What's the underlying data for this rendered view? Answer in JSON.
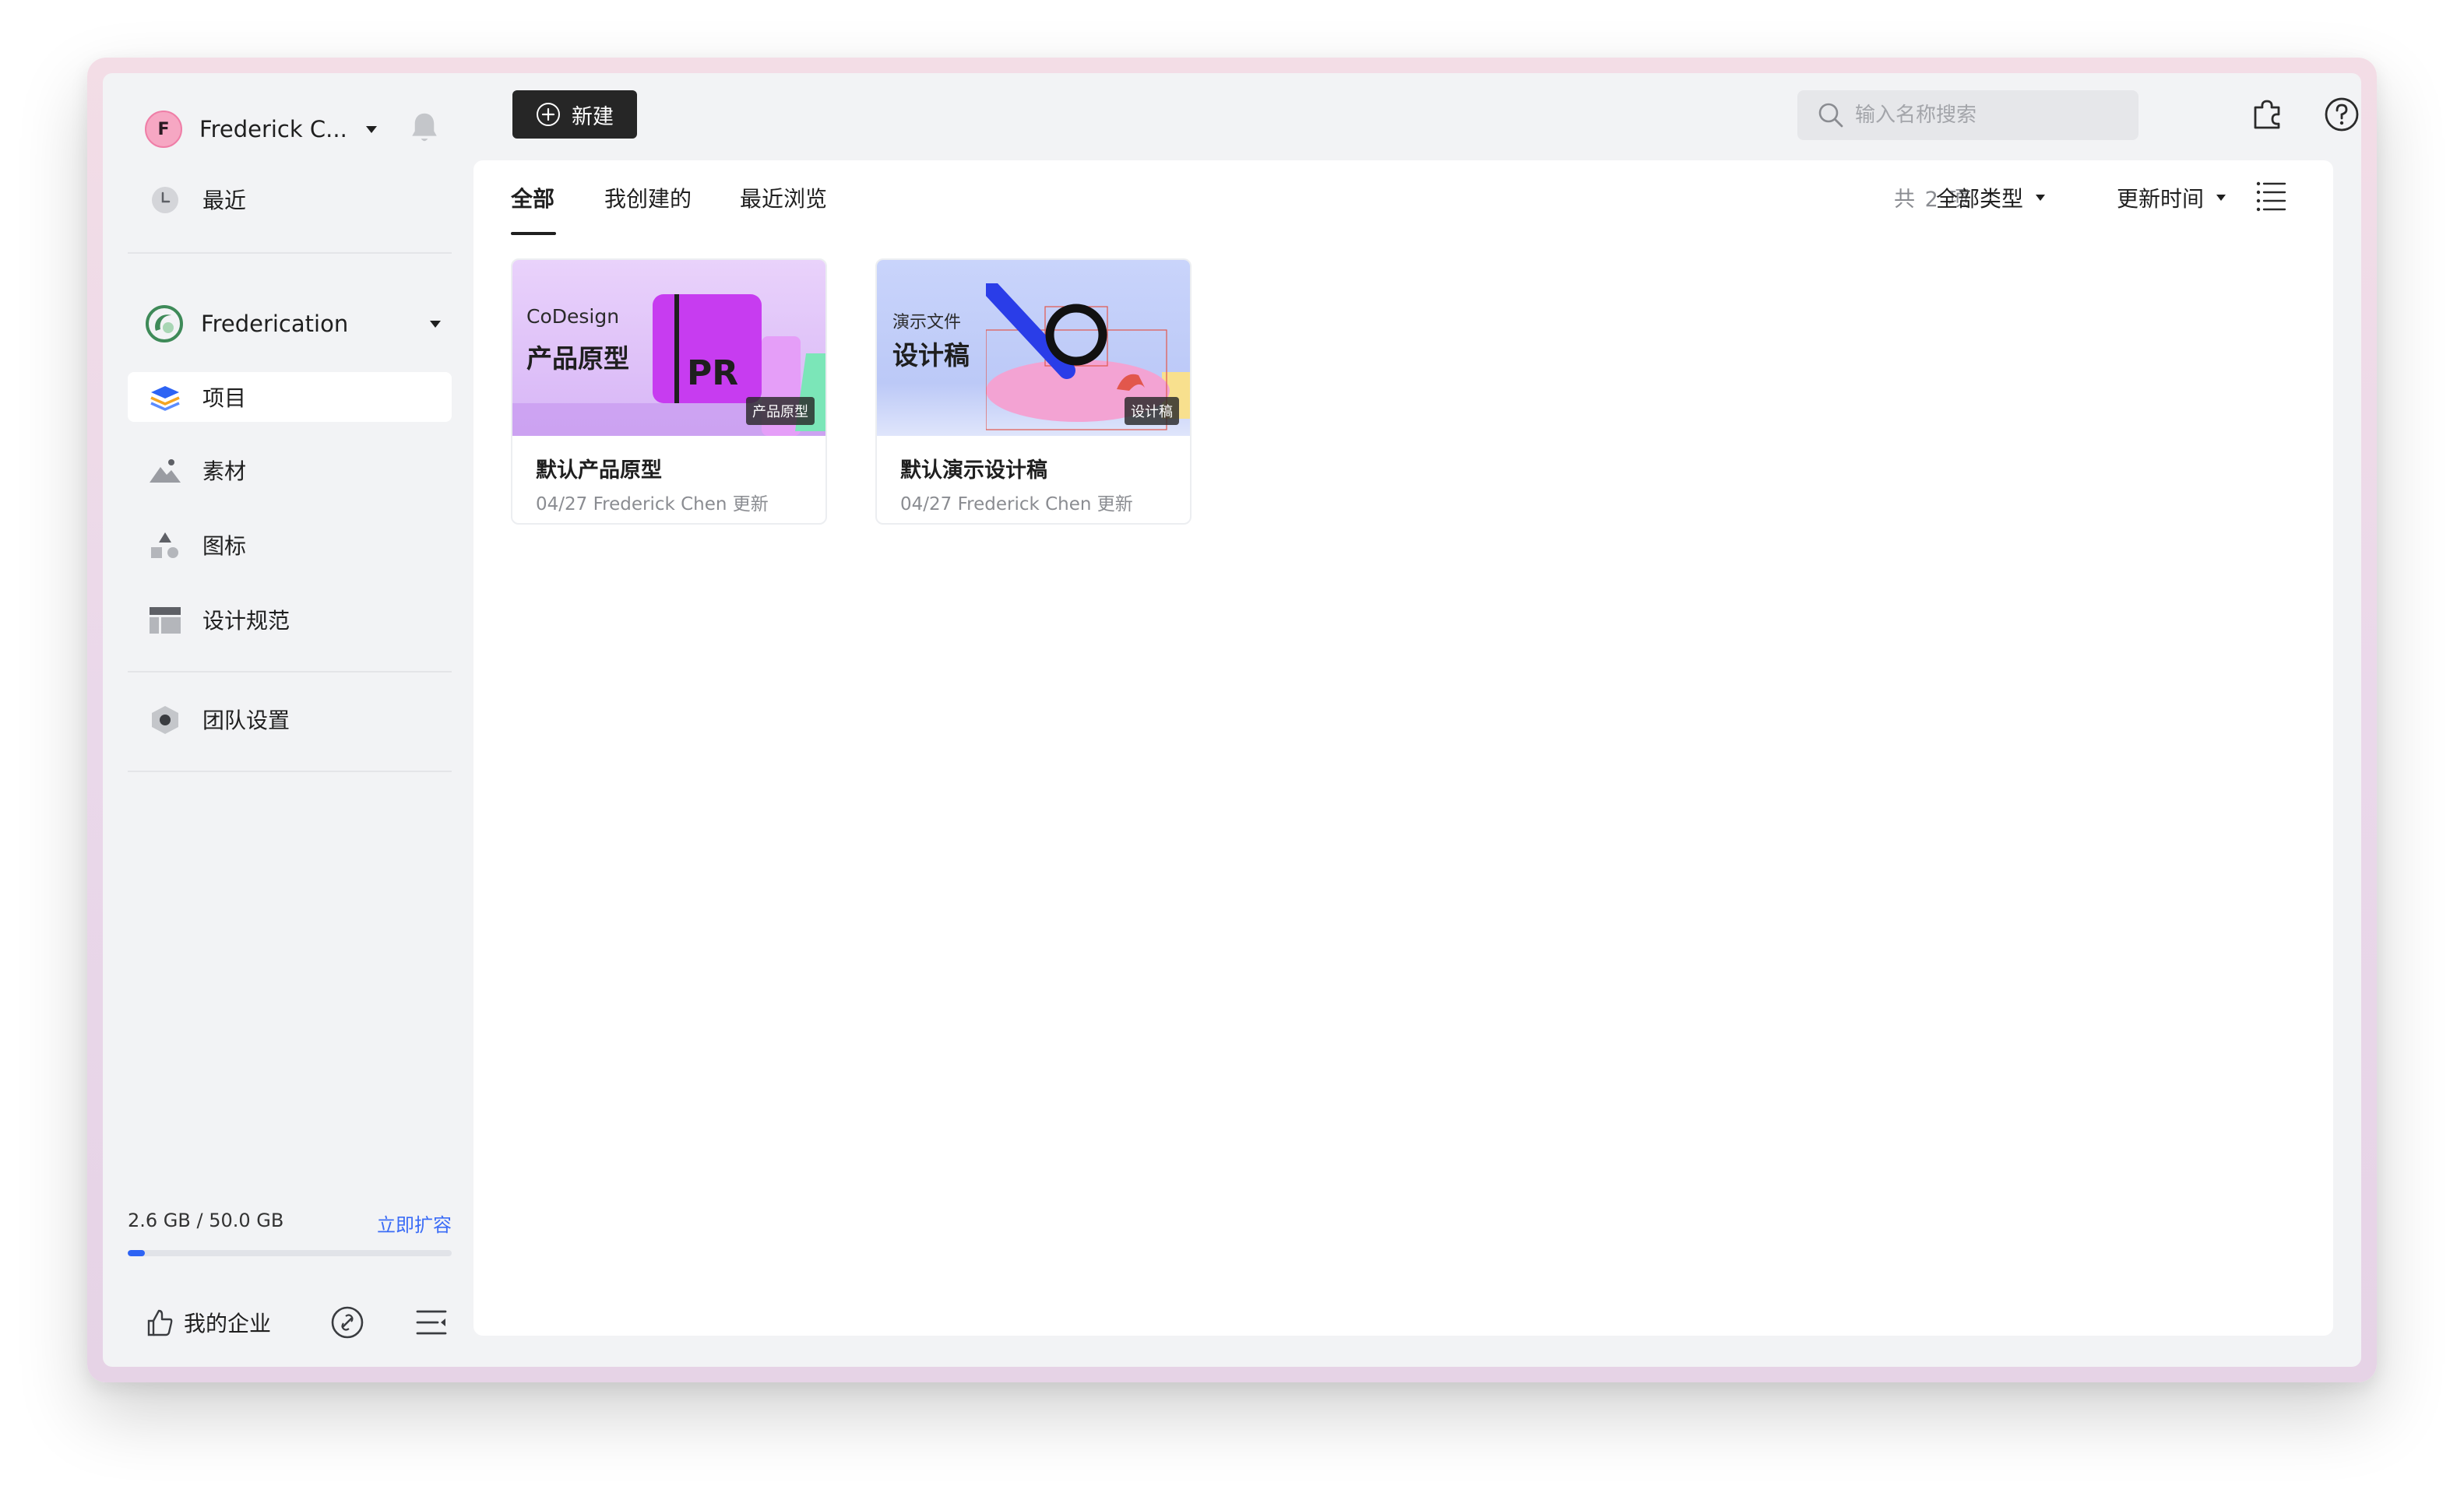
{
  "sidebar": {
    "user": {
      "initial": "F",
      "name": "Frederick C..."
    },
    "recent_label": "最近",
    "team": {
      "name": "Frederication"
    },
    "items": [
      {
        "label": "项目",
        "icon": "layers-icon",
        "active": true
      },
      {
        "label": "素材",
        "icon": "image-icon",
        "active": false
      },
      {
        "label": "图标",
        "icon": "shapes-icon",
        "active": false
      },
      {
        "label": "设计规范",
        "icon": "layout-icon",
        "active": false
      }
    ],
    "team_settings_label": "团队设置",
    "storage": {
      "used_text": "2.6 GB  /  50.0 GB",
      "used_gb": 2.6,
      "total_gb": 50.0,
      "expand_label": "立即扩容"
    },
    "enterprise_label": "我的企业"
  },
  "toolbar": {
    "new_label": "新建",
    "search_placeholder": "输入名称搜索"
  },
  "tabs": [
    {
      "label": "全部",
      "active": true
    },
    {
      "label": "我创建的",
      "active": false
    },
    {
      "label": "最近浏览",
      "active": false
    }
  ],
  "list_controls": {
    "count_text": "共 2 项",
    "type_filter": "全部类型",
    "sort_filter": "更新时间"
  },
  "cards": [
    {
      "title": "默认产品原型",
      "meta": "04/27 Frederick Chen 更新",
      "badge": "产品原型",
      "thumb_small": "CoDesign",
      "thumb_big": "产品原型",
      "thumb_logo": "PR"
    },
    {
      "title": "默认演示设计稿",
      "meta": "04/27 Frederick Chen 更新",
      "badge": "设计稿",
      "thumb_small": "演示文件",
      "thumb_big": "设计稿"
    }
  ],
  "colors": {
    "accent": "#2d63f4",
    "link": "#3b6cf6",
    "new_button_bg": "#262626",
    "avatar_bg": "#f6a7c3"
  }
}
